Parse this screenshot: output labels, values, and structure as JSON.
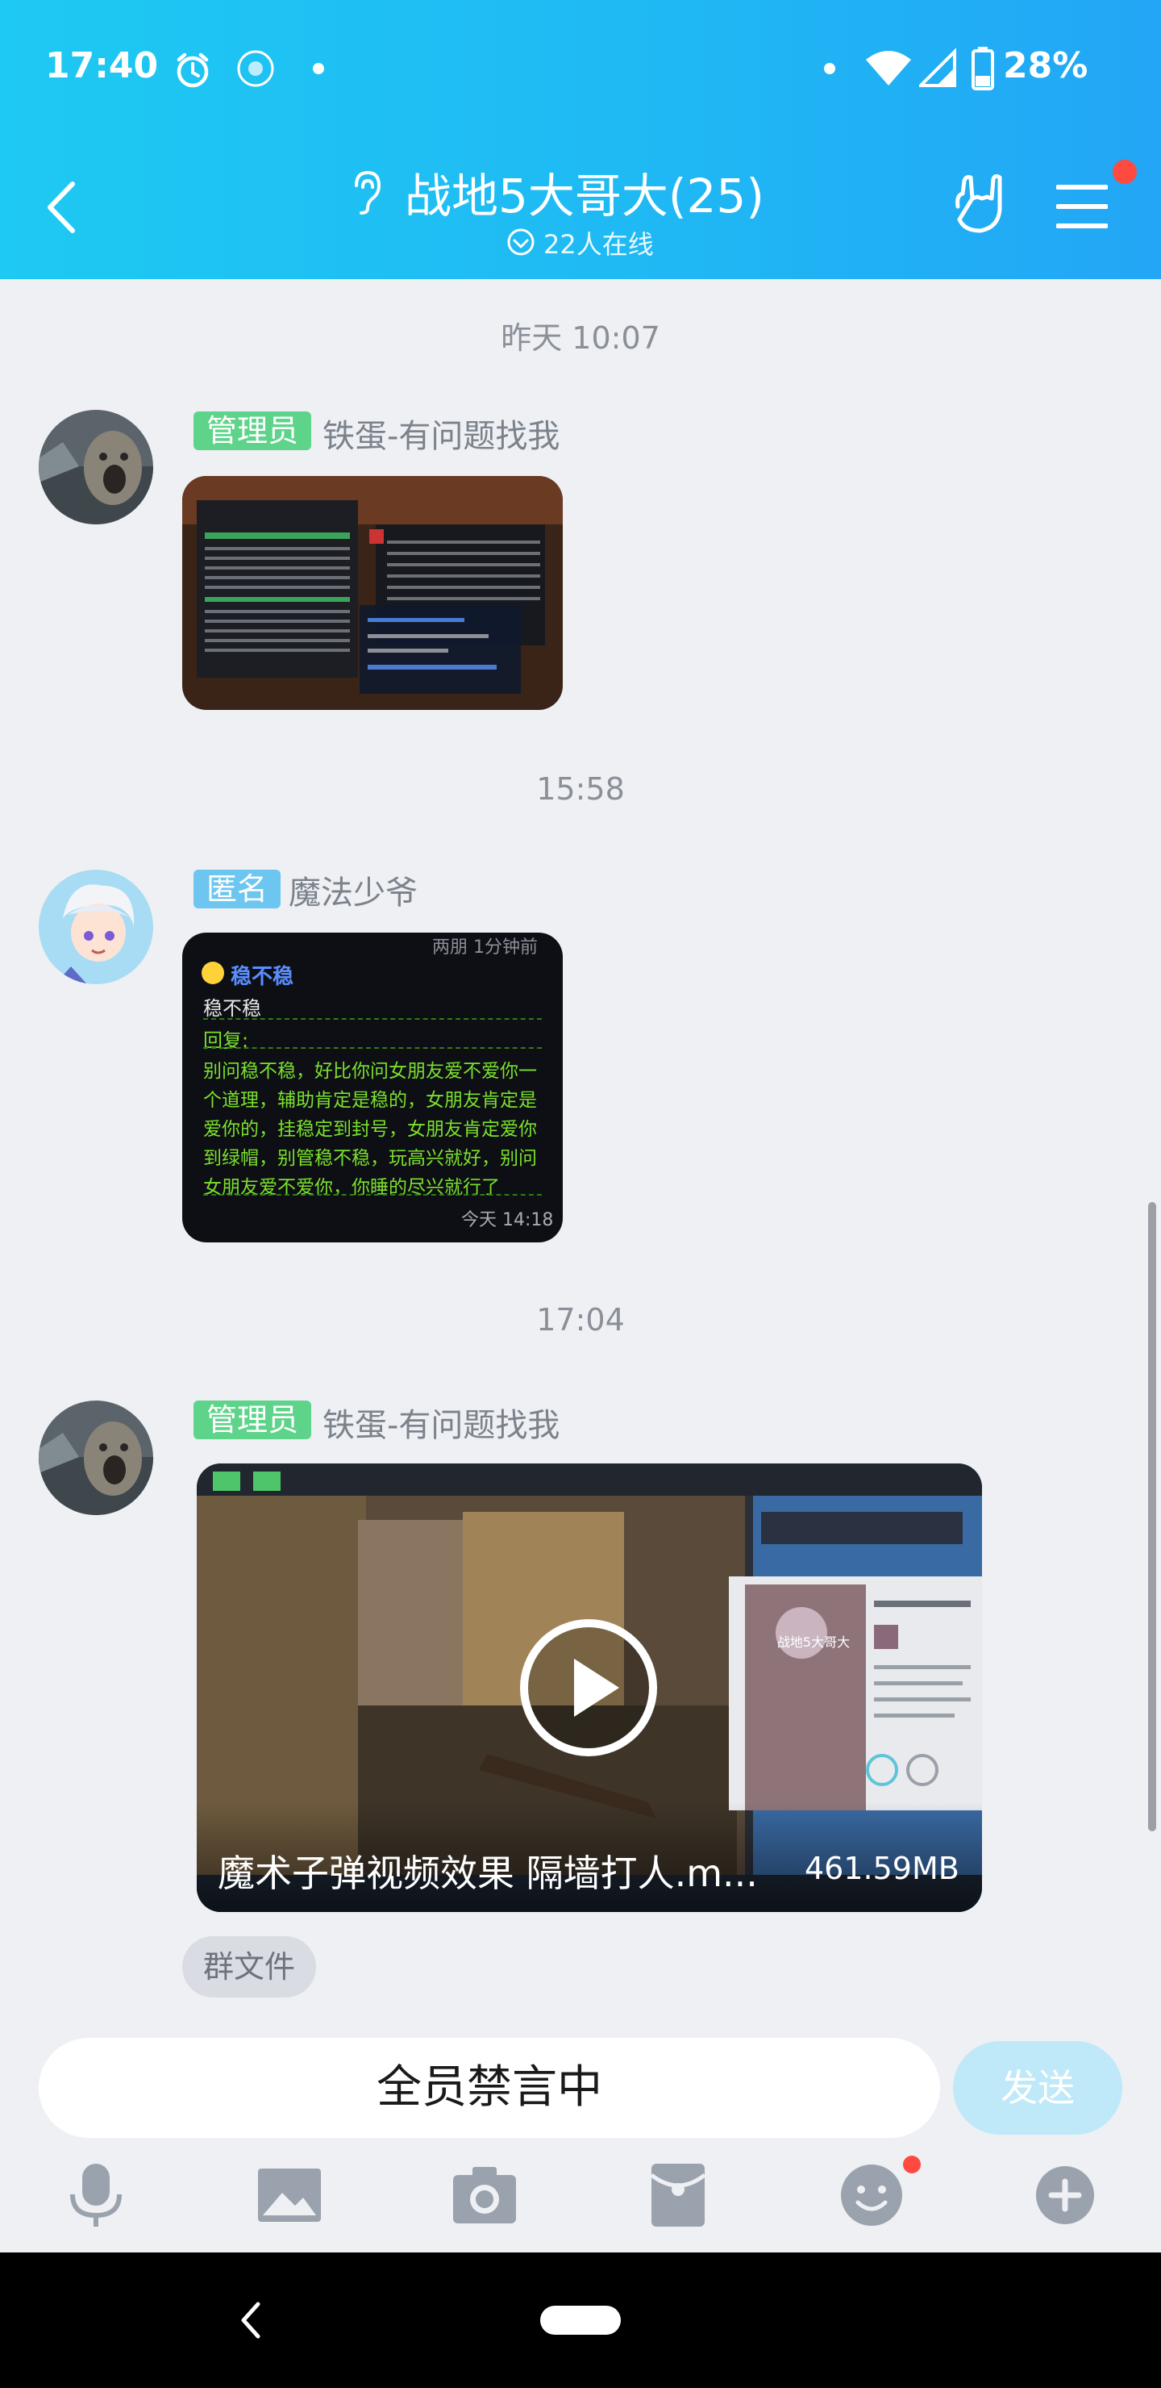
{
  "status_bar": {
    "time": "17:40",
    "battery": "28%"
  },
  "header": {
    "title": "战地5大哥大(25)",
    "online": "22人在线"
  },
  "messages": [
    {
      "time": "昨天 10:07",
      "role": "管理员",
      "sender": "铁蛋-有问题找我",
      "type": "image"
    },
    {
      "time": "15:58",
      "role": "匿名",
      "sender": "魔法少爷",
      "type": "image",
      "image_text": {
        "top": "两朋 1分钟前",
        "name": "稳不稳",
        "line1": "稳不稳",
        "reply_label": "回复:",
        "body": [
          "别问稳不稳，好比你问女朋友爱不爱你一",
          "个道理，辅助肯定是稳的，女朋友肯定是",
          "爱你的，挂稳定到封号，女朋友肯定爱你",
          "到绿帽，别管稳不稳，玩高兴就好，别问",
          "女朋友爱不爱你，你睡的尽兴就行了"
        ],
        "stamp": "今天 14:18"
      }
    },
    {
      "time": "17:04",
      "role": "管理员",
      "sender": "铁蛋-有问题找我",
      "type": "video",
      "video_title": "魔术子弹视频效果 隔墙打人.m...",
      "video_size": "461.59MB",
      "overlay": {
        "profile_name": "战地5大哥大"
      },
      "tag": "群文件"
    }
  ],
  "input": {
    "text": "全员禁言中",
    "send": "发送"
  },
  "colors": {
    "header": "#1fb9f4",
    "admin_badge": "#5ed48a",
    "anon_badge": "#6cc6f0",
    "send": "#bfe9f9"
  },
  "toolbar_icons": [
    "microphone-icon",
    "image-icon",
    "camera-icon",
    "red-packet-icon",
    "emoji-icon",
    "plus-icon"
  ]
}
